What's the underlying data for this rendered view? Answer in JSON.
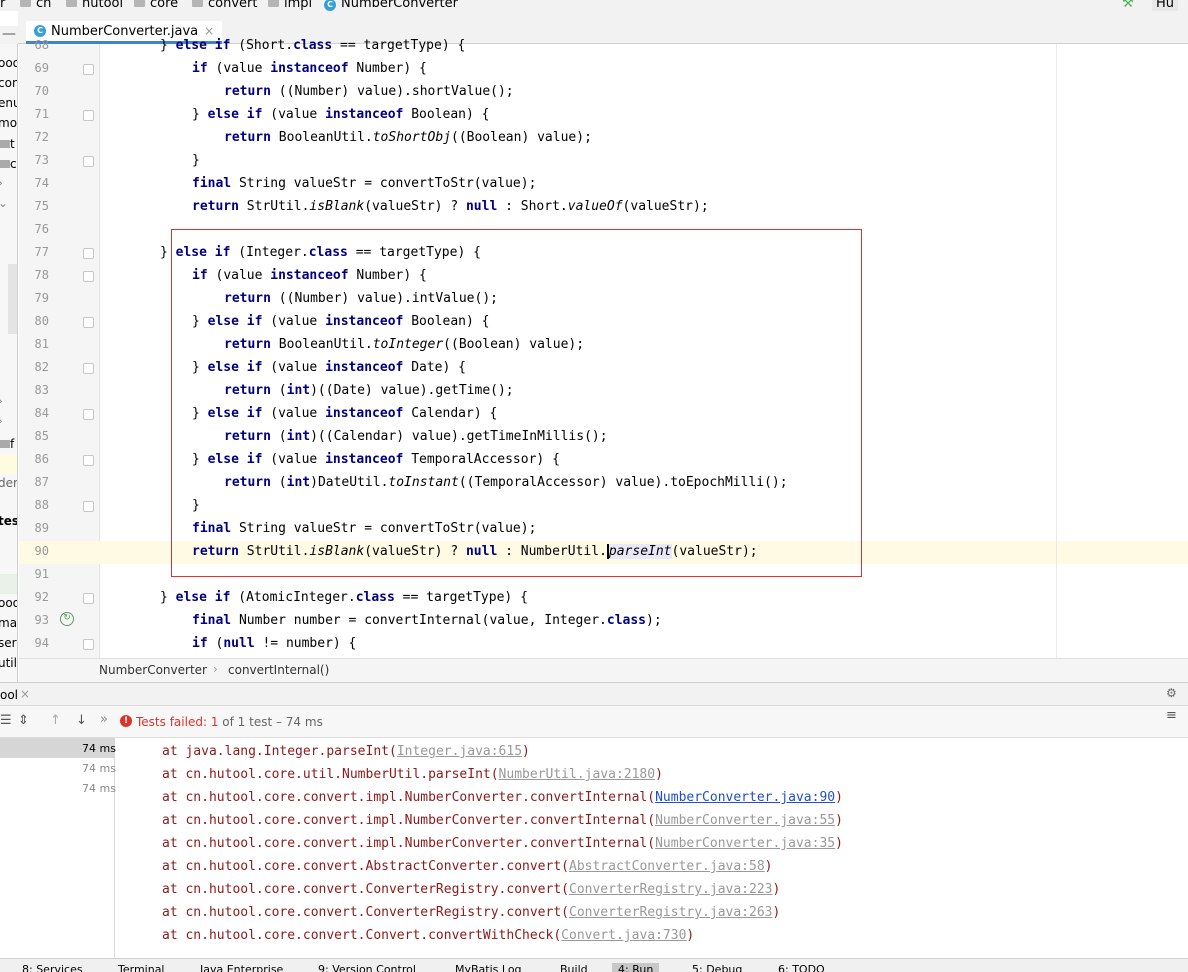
{
  "breadcrumb": {
    "items": [
      "r",
      "cn",
      "hutool",
      "core",
      "convert",
      "impl",
      "NumberConverter"
    ],
    "right_label": "Hu"
  },
  "tab": {
    "label": "NumberConverter.java",
    "close": "×",
    "icon": "java-class-icon"
  },
  "left_strip": [
    "ooo",
    "con",
    "enu",
    "mod",
    "t",
    "c",
    "f",
    "der-",
    "tes",
    "ooo",
    "map",
    "serv",
    "utils"
  ],
  "code_lines": [
    {
      "n": "68",
      "t": "} else if (Short.class == targetType) {"
    },
    {
      "n": "69",
      "t": "if (value instanceof Number) {"
    },
    {
      "n": "70",
      "t": "return ((Number) value).shortValue();"
    },
    {
      "n": "71",
      "t": "} else if (value instanceof Boolean) {"
    },
    {
      "n": "72",
      "t": "return BooleanUtil.toShortObj((Boolean) value);"
    },
    {
      "n": "73",
      "t": "}"
    },
    {
      "n": "74",
      "t": "final String valueStr = convertToStr(value);"
    },
    {
      "n": "75",
      "t": "return StrUtil.isBlank(valueStr) ? null : Short.valueOf(valueStr);"
    },
    {
      "n": "76",
      "t": ""
    },
    {
      "n": "77",
      "t": "} else if (Integer.class == targetType) {"
    },
    {
      "n": "78",
      "t": "if (value instanceof Number) {"
    },
    {
      "n": "79",
      "t": "return ((Number) value).intValue();"
    },
    {
      "n": "80",
      "t": "} else if (value instanceof Boolean) {"
    },
    {
      "n": "81",
      "t": "return BooleanUtil.toInteger((Boolean) value);"
    },
    {
      "n": "82",
      "t": "} else if (value instanceof Date) {"
    },
    {
      "n": "83",
      "t": "return (int)((Date) value).getTime();"
    },
    {
      "n": "84",
      "t": "} else if (value instanceof Calendar) {"
    },
    {
      "n": "85",
      "t": "return (int)((Calendar) value).getTimeInMillis();"
    },
    {
      "n": "86",
      "t": "} else if (value instanceof TemporalAccessor) {"
    },
    {
      "n": "87",
      "t": "return (int)DateUtil.toInstant((TemporalAccessor) value).toEpochMilli();"
    },
    {
      "n": "88",
      "t": "}"
    },
    {
      "n": "89",
      "t": "final String valueStr = convertToStr(value);"
    },
    {
      "n": "90",
      "t": "return StrUtil.isBlank(valueStr) ? null : NumberUtil.parseInt(valueStr);"
    },
    {
      "n": "91",
      "t": ""
    },
    {
      "n": "92",
      "t": "} else if (AtomicInteger.class == targetType) {"
    },
    {
      "n": "93",
      "t": "final Number number = convertInternal(value, Integer.class);"
    },
    {
      "n": "94",
      "t": "if (null != number) {"
    }
  ],
  "editor_breadcrumb": {
    "class_name": "NumberConverter",
    "method": "convertInternal()"
  },
  "run_panel": {
    "tab_label": "ool",
    "status_prefix": "Tests failed:",
    "failed_count": "1",
    "status_suffix": "of 1 test – 74 ms",
    "tree_times": [
      "74 ms",
      "74 ms",
      "74 ms"
    ]
  },
  "stack_trace": [
    {
      "text": "at java.lang.Integer.parseInt(",
      "link": "Integer.java:615",
      "end": ")",
      "active": false
    },
    {
      "text": "at cn.hutool.core.util.NumberUtil.parseInt(",
      "link": "NumberUtil.java:2180",
      "end": ")",
      "active": false
    },
    {
      "text": "at cn.hutool.core.convert.impl.NumberConverter.convertInternal(",
      "link": "NumberConverter.java:90",
      "end": ")",
      "active": true
    },
    {
      "text": "at cn.hutool.core.convert.impl.NumberConverter.convertInternal(",
      "link": "NumberConverter.java:55",
      "end": ")",
      "active": false
    },
    {
      "text": "at cn.hutool.core.convert.impl.NumberConverter.convertInternal(",
      "link": "NumberConverter.java:35",
      "end": ")",
      "active": false
    },
    {
      "text": "at cn.hutool.core.convert.AbstractConverter.convert(",
      "link": "AbstractConverter.java:58",
      "end": ")",
      "active": false
    },
    {
      "text": "at cn.hutool.core.convert.ConverterRegistry.convert(",
      "link": "ConverterRegistry.java:223",
      "end": ")",
      "active": false
    },
    {
      "text": "at cn.hutool.core.convert.ConverterRegistry.convert(",
      "link": "ConverterRegistry.java:263",
      "end": ")",
      "active": false
    },
    {
      "text": "at cn.hutool.core.convert.Convert.convertWithCheck(",
      "link": "Convert.java:730",
      "end": ")",
      "active": false
    }
  ],
  "bottom_tools": [
    "8: Services",
    "Terminal",
    "Java Enterprise",
    "9: Version Control",
    "MyBatis Log",
    "Build",
    "4: Run",
    "5: Debug",
    "6: TODO"
  ],
  "colors": {
    "keyword": "#000080",
    "highlight_box": "#e03030",
    "current_line": "#fffae3",
    "error_text": "#8b1a1a",
    "link": "#1f4fcf",
    "fail_icon": "#d9342b"
  }
}
